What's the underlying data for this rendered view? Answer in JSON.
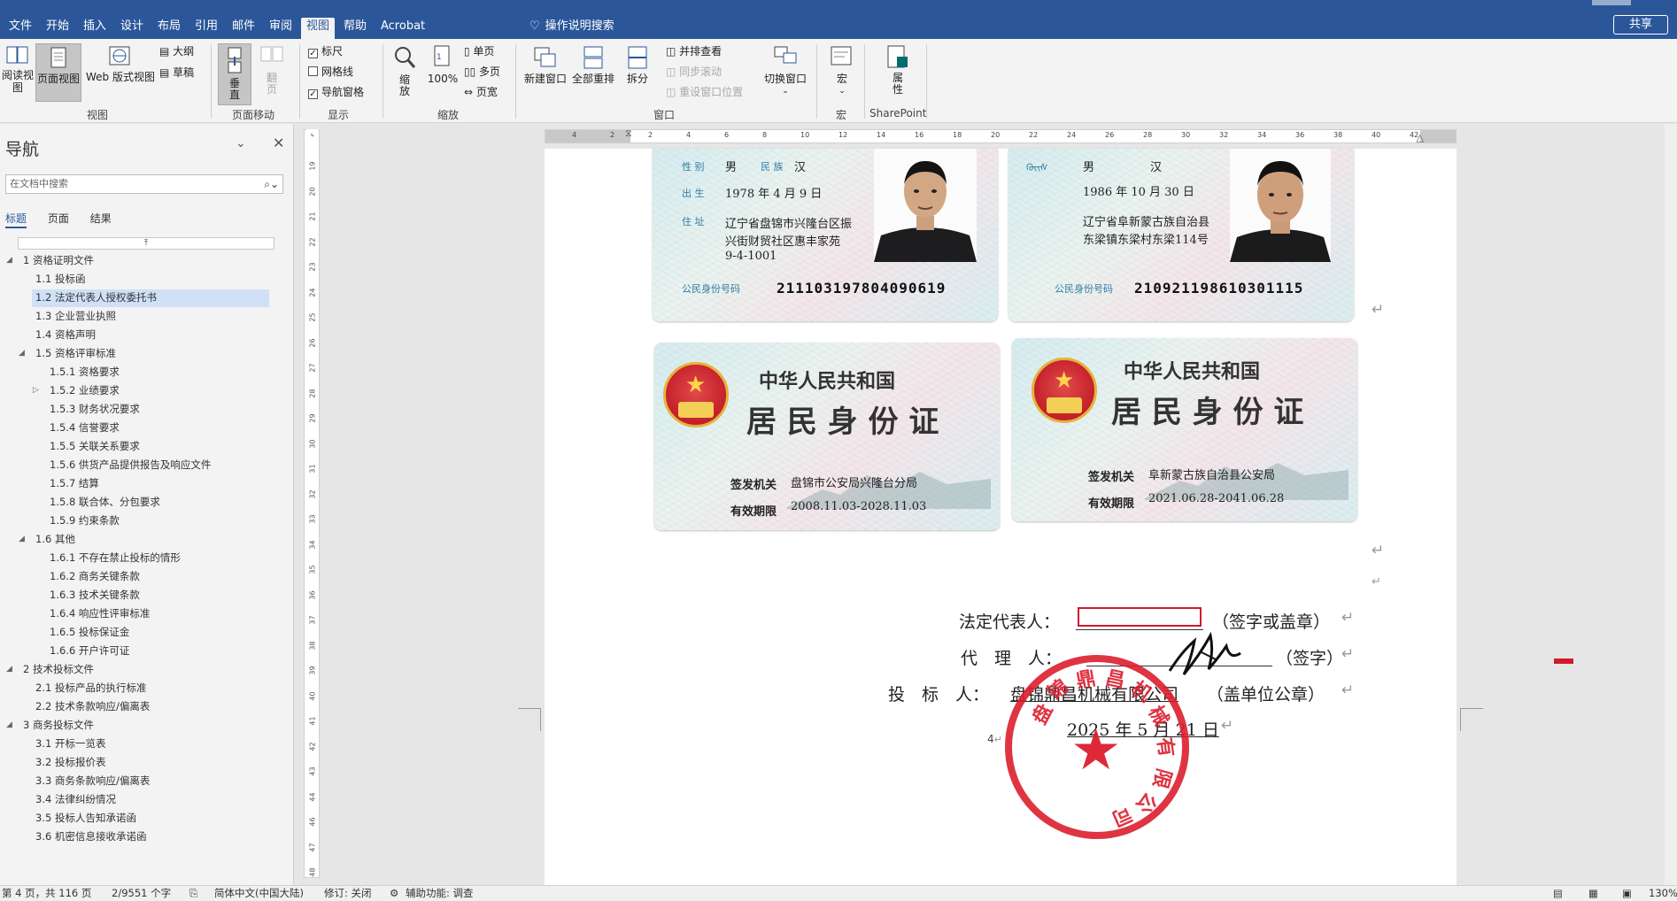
{
  "menubar": {
    "tabs": [
      "文件",
      "开始",
      "插入",
      "设计",
      "布局",
      "引用",
      "邮件",
      "审阅",
      "视图",
      "帮助",
      "Acrobat"
    ],
    "active_tab": "视图",
    "tell_me": "操作说明搜索",
    "share": "共享"
  },
  "ribbon": {
    "view": {
      "read_mode": "阅读视图",
      "print_layout": "页面视图",
      "web_layout": "Web 版式视图",
      "outline": "大纲",
      "draft": "草稿",
      "group": "视图"
    },
    "page_movement": {
      "vertical": "垂直",
      "side_to_side": "翻页",
      "group": "页面移动"
    },
    "show": {
      "ruler": "标尺",
      "gridlines": "网格线",
      "nav_pane": "导航窗格",
      "group": "显示"
    },
    "zoom": {
      "zoom": "缩放",
      "hundred": "100%",
      "one_page": "单页",
      "multi_page": "多页",
      "page_width": "页宽",
      "group": "缩放"
    },
    "window": {
      "new_window": "新建窗口",
      "arrange_all": "全部重排",
      "split": "拆分",
      "side_by_side": "并排查看",
      "sync_scroll": "同步滚动",
      "reset_position": "重设窗口位置",
      "switch": "切换窗口",
      "group": "窗口"
    },
    "macros": {
      "label": "宏",
      "group": "宏"
    },
    "sharepoint": {
      "label": "属性",
      "group": "SharePoint"
    }
  },
  "nav": {
    "title": "导航",
    "search_placeholder": "在文档中搜索",
    "tabs": [
      "标题",
      "页面",
      "结果"
    ],
    "items": [
      {
        "label": "1 资格证明文件",
        "level": 0,
        "expanded": true
      },
      {
        "label": "1.1 投标函",
        "level": 1
      },
      {
        "label": "1.2 法定代表人授权委托书",
        "level": 1,
        "selected": true
      },
      {
        "label": "1.3 企业营业执照",
        "level": 1
      },
      {
        "label": "1.4 资格声明",
        "level": 1
      },
      {
        "label": "1.5 资格评审标准",
        "level": 1,
        "expanded": true
      },
      {
        "label": "1.5.1 资格要求",
        "level": 2
      },
      {
        "label": "1.5.2 业绩要求",
        "level": 2,
        "collapsed": true
      },
      {
        "label": "1.5.3 财务状况要求",
        "level": 2
      },
      {
        "label": "1.5.4 信誉要求",
        "level": 2
      },
      {
        "label": "1.5.5 关联关系要求",
        "level": 2
      },
      {
        "label": "1.5.6 供货产品提供报告及响应文件",
        "level": 2
      },
      {
        "label": "1.5.7 结算",
        "level": 2
      },
      {
        "label": "1.5.8 联合体、分包要求",
        "level": 2
      },
      {
        "label": "1.5.9 约束条款",
        "level": 2
      },
      {
        "label": "1.6 其他",
        "level": 1,
        "expanded": true
      },
      {
        "label": "1.6.1 不存在禁止投标的情形",
        "level": 2
      },
      {
        "label": "1.6.2 商务关键条款",
        "level": 2
      },
      {
        "label": "1.6.3 技术关键条款",
        "level": 2
      },
      {
        "label": "1.6.4 响应性评审标准",
        "level": 2
      },
      {
        "label": "1.6.5 投标保证金",
        "level": 2
      },
      {
        "label": "1.6.6 开户许可证",
        "level": 2
      },
      {
        "label": "2 技术投标文件",
        "level": 0,
        "expanded": true
      },
      {
        "label": "2.1 投标产品的执行标准",
        "level": 1
      },
      {
        "label": "2.2 技术条款响应/偏离表",
        "level": 1
      },
      {
        "label": "3 商务投标文件",
        "level": 0,
        "expanded": true
      },
      {
        "label": "3.1 开标一览表",
        "level": 1
      },
      {
        "label": "3.2 投标报价表",
        "level": 1
      },
      {
        "label": "3.3 商务条款响应/偏离表",
        "level": 1
      },
      {
        "label": "3.4 法律纠纷情况",
        "level": 1
      },
      {
        "label": "3.5 投标人告知承诺函",
        "level": 1
      },
      {
        "label": "3.6 机密信息接收承诺函",
        "level": 1
      }
    ]
  },
  "ruler": {
    "h_ticks": [
      "4",
      "2",
      "2",
      "4",
      "6",
      "8",
      "10",
      "12",
      "14",
      "16",
      "18",
      "20",
      "22",
      "24",
      "26",
      "28",
      "30",
      "32",
      "34",
      "36",
      "38",
      "40",
      "42"
    ],
    "v_ticks": [
      "19",
      "20",
      "21",
      "22",
      "23",
      "24",
      "25",
      "26",
      "27",
      "28",
      "29",
      "30",
      "31",
      "32",
      "33",
      "34",
      "35",
      "36",
      "37",
      "38",
      "39",
      "40",
      "41",
      "42",
      "43",
      "44",
      "46",
      "47",
      "48"
    ]
  },
  "document": {
    "card1_front": {
      "gender_label": "性 别",
      "gender": "男",
      "ethnic_label": "民 族",
      "ethnic": "汉",
      "birth_label": "出 生",
      "birth": "1978 年 4 月 9 日",
      "address_label": "住 址",
      "address_lines": [
        "辽宁省盘锦市兴隆台区振",
        "兴街财贸社区惠丰家苑",
        "9-4-1001"
      ],
      "id_label": "公民身份号码",
      "id_number": "211103197804090619"
    },
    "card2_front": {
      "gender": "男",
      "ethnic": "汉",
      "birth": "1986 年 10 月 30 日",
      "address_lines": [
        "辽宁省阜新蒙古族自治县",
        "东梁镇东梁村东梁114号"
      ],
      "id_label": "公民身份号码",
      "id_number": "210921198610301115"
    },
    "card1_back": {
      "title_top": "中华人民共和国",
      "title_main": "居 民 身 份 证",
      "authority_label": "签发机关",
      "authority": "盘锦市公安局兴隆台分局",
      "validity_label": "有效期限",
      "validity": "2008.11.03-2028.11.03"
    },
    "card2_back": {
      "title_top": "中华人民共和国",
      "title_main": "居 民 身 份 证",
      "authority_label": "签发机关",
      "authority": "阜新蒙古族自治县公安局",
      "validity_label": "有效期限",
      "validity": "2021.06.28-2041.06.28"
    },
    "legal_rep_label": "法定代表人：",
    "legal_rep_suffix": "（签字或盖章）",
    "agent_label": "代　理　人：",
    "agent_suffix": "（签字）",
    "bidder_label": "投　标　人：",
    "bidder_name": "盘锦鼎昌机械有限公司",
    "bidder_suffix": "（盖单位公章）",
    "date": "2025 年 5 月 21 日",
    "page_number": "4",
    "stamp_text": "盘锦鼎昌机械有限公司"
  },
  "status": {
    "page": "第 4 页，共 116 页",
    "words": "2/9551 个字",
    "language": "简体中文(中国大陆)",
    "track_changes": "修订: 关闭",
    "accessibility": "辅助功能: 调查",
    "zoom": "130%"
  }
}
